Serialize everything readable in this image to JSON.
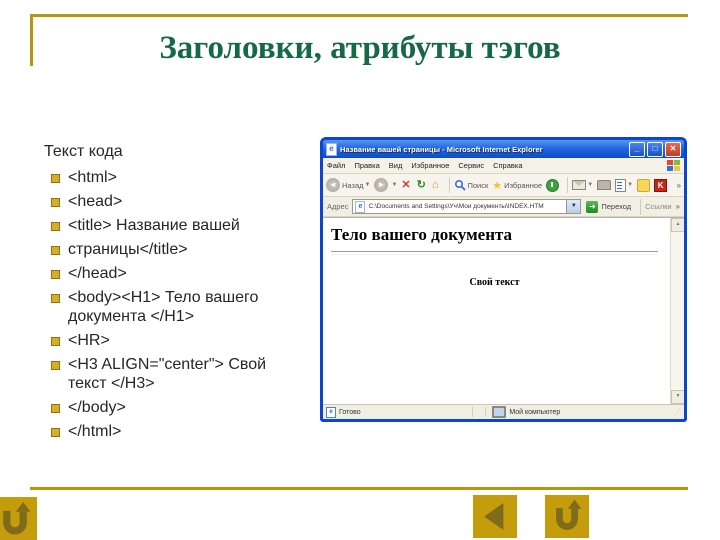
{
  "slide": {
    "title": "Заголовки, атрибуты тэгов",
    "code_heading": "Текст кода",
    "code_lines": [
      "<html>",
      "<head>",
      "<title> Название вашей",
      "страницы</title>",
      "</head>",
      "<body><H1> Тело вашего документа </H1>",
      "<HR>",
      "<H3 ALIGN=\"center\"> Свой текст </H3>",
      "</body>",
      "</html>"
    ]
  },
  "browser": {
    "window_title": "Название вашей страницы - Microsoft Internet Explorer",
    "menu_items": [
      "Файл",
      "Правка",
      "Вид",
      "Избранное",
      "Сервис",
      "Справка"
    ],
    "toolbar": {
      "back_label": "Назад",
      "search_label": "Поиск",
      "favorites_label": "Избранное",
      "more_chevron": "»"
    },
    "address_bar": {
      "label": "Адрес",
      "value": "C:\\Documents and Settings\\Уч\\Мои документы\\INDEX.HTM",
      "go_label": "Переход",
      "links_label": "Ссылки",
      "more_chevron": "»"
    },
    "page": {
      "heading": "Тело вашего документа",
      "subtext": "Свой текст"
    },
    "status_bar": {
      "left": "Готово",
      "right": "Мой компьютер"
    }
  },
  "colors": {
    "accent_gold": "#B8960B",
    "title_green": "#166847",
    "titlebar_blue": "#0C4CC8",
    "close_red": "#C33B22"
  }
}
